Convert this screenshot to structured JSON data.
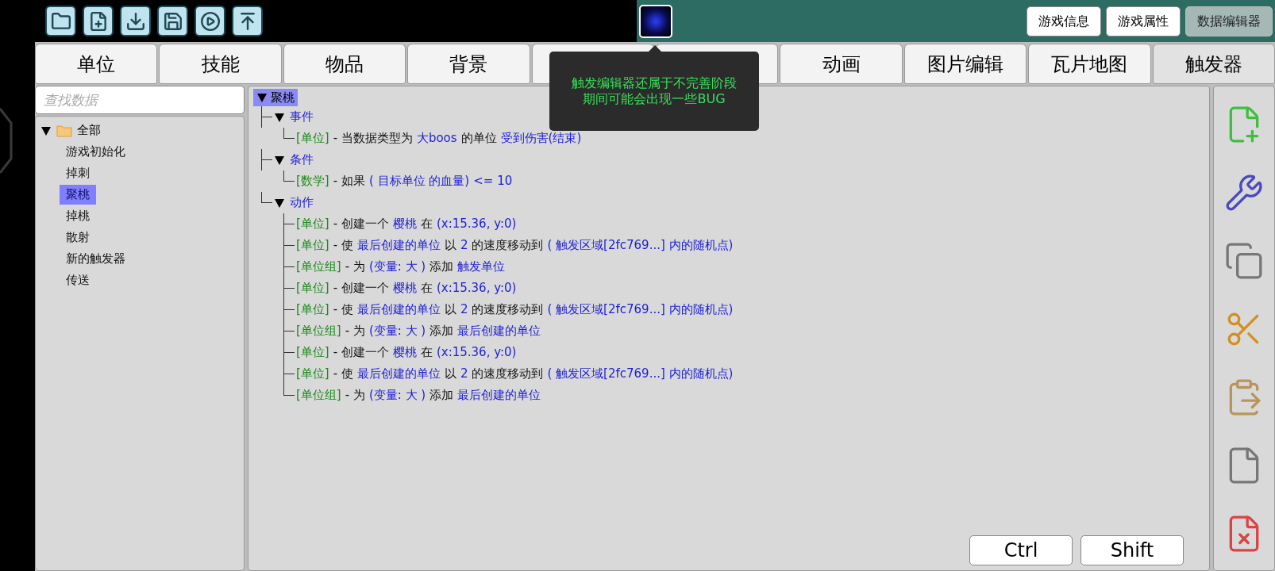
{
  "top_buttons": [
    {
      "label": "游戏信息",
      "disabled": false
    },
    {
      "label": "游戏属性",
      "disabled": false
    },
    {
      "label": "数据编辑器",
      "disabled": true
    }
  ],
  "tabs": [
    {
      "label": "单位",
      "selected": false
    },
    {
      "label": "技能",
      "selected": false
    },
    {
      "label": "物品",
      "selected": false
    },
    {
      "label": "背景",
      "selected": false
    },
    {
      "selected": false
    },
    {
      "selected": false
    },
    {
      "label": "动画",
      "selected": false
    },
    {
      "label": "图片编辑",
      "selected": false
    },
    {
      "label": "瓦片地图",
      "selected": false
    },
    {
      "label": "触发器",
      "selected": true
    }
  ],
  "tooltip": {
    "lines": [
      "触发编辑器还属于不完善阶段",
      "期间可能会出现一些BUG"
    ]
  },
  "sidebar": {
    "search": {
      "placeholder": "查找数据"
    },
    "tree": {
      "label": "全部",
      "expanded": true,
      "children": [
        {
          "label": "游戏初始化",
          "selected": false
        },
        {
          "label": "掉刺",
          "selected": false
        },
        {
          "label": "聚桃",
          "selected": true
        },
        {
          "label": "掉桃",
          "selected": false
        },
        {
          "label": "散射",
          "selected": false
        },
        {
          "label": "新的触发器",
          "selected": false
        },
        {
          "label": "传送",
          "selected": false
        }
      ]
    }
  },
  "trigger": {
    "label": "聚桃",
    "selected": true,
    "expanded": true,
    "children": [
      {
        "label": "事件",
        "expanded": true,
        "children": [
          {
            "parts": [
              {
                "kind": "category",
                "text": "[单位]"
              },
              {
                "kind": "plain",
                "text": "- 当数据类型为"
              },
              {
                "kind": "value",
                "text": "大boos"
              },
              {
                "kind": "plain",
                "text": "的单位"
              },
              {
                "kind": "value",
                "text": "受到伤害(结束)"
              }
            ]
          }
        ]
      },
      {
        "label": "条件",
        "expanded": true,
        "children": [
          {
            "parts": [
              {
                "kind": "category",
                "text": "[数学]"
              },
              {
                "kind": "plain",
                "text": "- 如果"
              },
              {
                "kind": "value",
                "text": "( 目标单位 的血量)"
              },
              {
                "kind": "value",
                "text": "<="
              },
              {
                "kind": "value",
                "text": "10"
              }
            ]
          }
        ]
      },
      {
        "label": "动作",
        "expanded": true,
        "children": [
          {
            "parts": [
              {
                "kind": "category",
                "text": "[单位]"
              },
              {
                "kind": "plain",
                "text": "- 创建一个"
              },
              {
                "kind": "value",
                "text": "樱桃"
              },
              {
                "kind": "plain",
                "text": "在"
              },
              {
                "kind": "value",
                "text": "(x:15.36, y:0)"
              }
            ]
          },
          {
            "parts": [
              {
                "kind": "category",
                "text": "[单位]"
              },
              {
                "kind": "plain",
                "text": "- 使"
              },
              {
                "kind": "value",
                "text": "最后创建的单位"
              },
              {
                "kind": "plain",
                "text": "以"
              },
              {
                "kind": "value",
                "text": "2"
              },
              {
                "kind": "plain",
                "text": "的速度移动到"
              },
              {
                "kind": "value",
                "text": "( 触发区域[2fc769...] 内的随机点)"
              }
            ]
          },
          {
            "parts": [
              {
                "kind": "category",
                "text": "[单位组]"
              },
              {
                "kind": "plain",
                "text": "- 为"
              },
              {
                "kind": "value",
                "text": "(变量: 大 )"
              },
              {
                "kind": "plain",
                "text": "添加"
              },
              {
                "kind": "value",
                "text": "触发单位"
              }
            ]
          },
          {
            "parts": [
              {
                "kind": "category",
                "text": "[单位]"
              },
              {
                "kind": "plain",
                "text": "- 创建一个"
              },
              {
                "kind": "value",
                "text": "樱桃"
              },
              {
                "kind": "plain",
                "text": "在"
              },
              {
                "kind": "value",
                "text": "(x:15.36, y:0)"
              }
            ]
          },
          {
            "parts": [
              {
                "kind": "category",
                "text": "[单位]"
              },
              {
                "kind": "plain",
                "text": "- 使"
              },
              {
                "kind": "value",
                "text": "最后创建的单位"
              },
              {
                "kind": "plain",
                "text": "以"
              },
              {
                "kind": "value",
                "text": "2"
              },
              {
                "kind": "plain",
                "text": "的速度移动到"
              },
              {
                "kind": "value",
                "text": "( 触发区域[2fc769...] 内的随机点)"
              }
            ]
          },
          {
            "parts": [
              {
                "kind": "category",
                "text": "[单位组]"
              },
              {
                "kind": "plain",
                "text": "- 为"
              },
              {
                "kind": "value",
                "text": "(变量: 大 )"
              },
              {
                "kind": "plain",
                "text": "添加"
              },
              {
                "kind": "value",
                "text": "最后创建的单位"
              }
            ]
          },
          {
            "parts": [
              {
                "kind": "category",
                "text": "[单位]"
              },
              {
                "kind": "plain",
                "text": "- 创建一个"
              },
              {
                "kind": "value",
                "text": "樱桃"
              },
              {
                "kind": "plain",
                "text": "在"
              },
              {
                "kind": "value",
                "text": "(x:15.36, y:0)"
              }
            ]
          },
          {
            "parts": [
              {
                "kind": "category",
                "text": "[单位]"
              },
              {
                "kind": "plain",
                "text": "- 使"
              },
              {
                "kind": "value",
                "text": "最后创建的单位"
              },
              {
                "kind": "plain",
                "text": "以"
              },
              {
                "kind": "value",
                "text": "2"
              },
              {
                "kind": "plain",
                "text": "的速度移动到"
              },
              {
                "kind": "value",
                "text": "( 触发区域[2fc769...] 内的随机点)"
              }
            ]
          },
          {
            "parts": [
              {
                "kind": "category",
                "text": "[单位组]"
              },
              {
                "kind": "plain",
                "text": "- 为"
              },
              {
                "kind": "value",
                "text": "(变量: 大 )"
              },
              {
                "kind": "plain",
                "text": "添加"
              },
              {
                "kind": "value",
                "text": "最后创建的单位"
              }
            ]
          }
        ]
      }
    ]
  },
  "modifier_keys": [
    "Ctrl",
    "Shift"
  ]
}
